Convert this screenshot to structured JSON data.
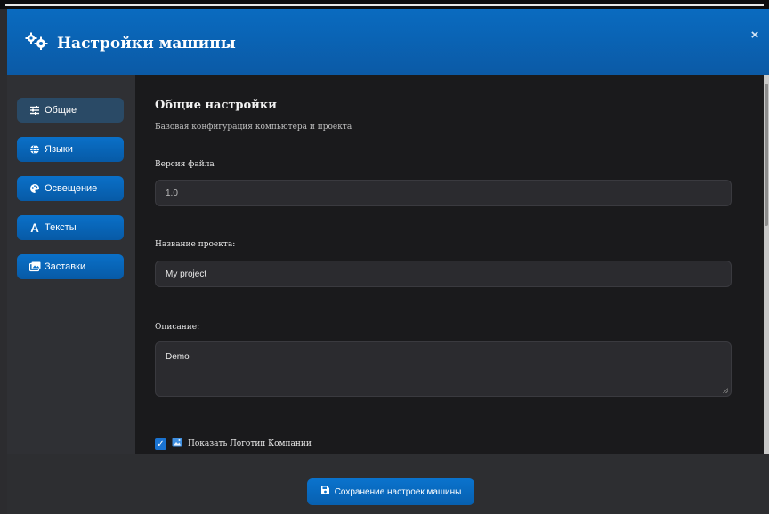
{
  "header": {
    "title": "Настройки машины",
    "close": "×"
  },
  "sidebar": {
    "items": [
      {
        "label": "Общие",
        "icon": "sliders-icon",
        "active": true
      },
      {
        "label": "Языки",
        "icon": "globe-icon",
        "active": false
      },
      {
        "label": "Освещение",
        "icon": "palette-icon",
        "active": false
      },
      {
        "label": "Тексты",
        "icon": "font-icon",
        "active": false
      },
      {
        "label": "Заставки",
        "icon": "images-icon",
        "active": false
      }
    ]
  },
  "section": {
    "title": "Общие настройки",
    "subtitle": "Базовая конфигурация компьютера и проекта"
  },
  "fields": {
    "version": {
      "label": "Версия файла",
      "value": "1.0"
    },
    "project": {
      "label": "Название проекта:",
      "value": "My project"
    },
    "description": {
      "label": "Описание:",
      "value": "Demo"
    }
  },
  "checkbox": {
    "label": "Показать Логотип Компании",
    "checked": true
  },
  "footer": {
    "save_label": "Сохранение настроек машины"
  },
  "colors": {
    "accent": "#0a6bc0",
    "background": "#1a1a1c",
    "sidebar": "#2f3034"
  }
}
